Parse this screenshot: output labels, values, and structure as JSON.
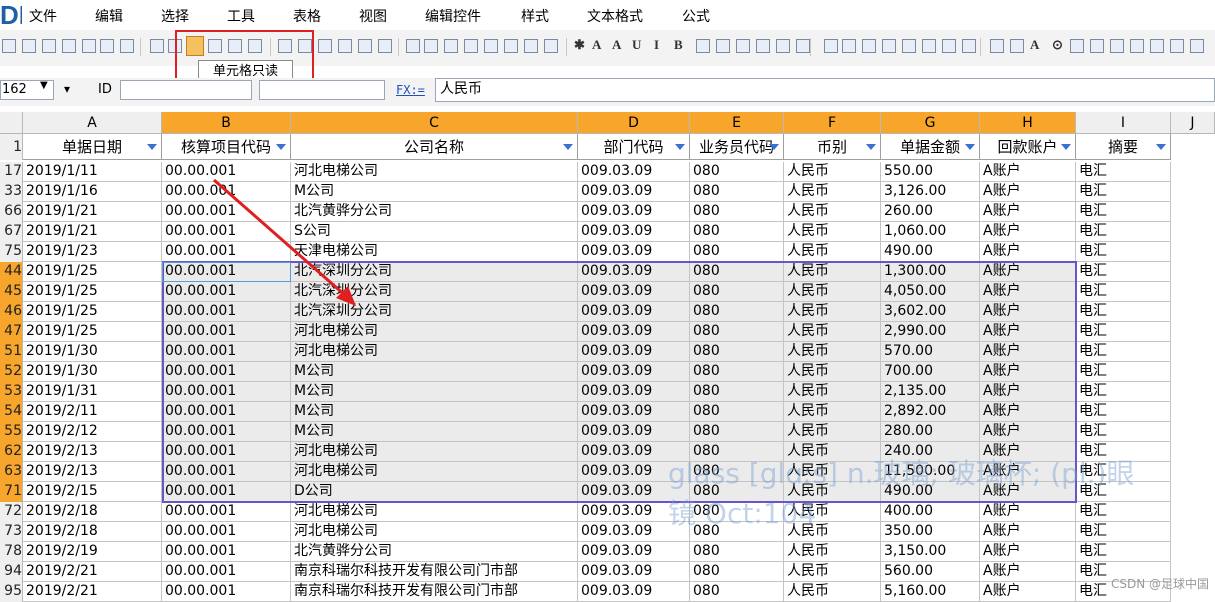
{
  "app": {
    "logo": "DE"
  },
  "menu": {
    "items": [
      "文件",
      "编辑",
      "选择",
      "工具",
      "表格",
      "视图",
      "编辑控件",
      "样式",
      "文本格式",
      "公式"
    ]
  },
  "toolbar": {
    "tooltip": "单元格只读"
  },
  "formula_bar": {
    "name_box": "162",
    "id_label": "ID",
    "id_value": "",
    "id_value2": "",
    "fx_label": "FX:=",
    "formula": "人民币"
  },
  "columns": [
    "A",
    "B",
    "C",
    "D",
    "E",
    "F",
    "G",
    "H",
    "I",
    "J"
  ],
  "header_row_label": "1",
  "headers": [
    "单据日期",
    "核算项目代码",
    "公司名称",
    "部门代码",
    "业务员代码",
    "币别",
    "单据金额",
    "回款账户",
    "摘要"
  ],
  "rows": [
    {
      "n": "17",
      "d": [
        "2019/1/11",
        "00.00.001",
        "河北电梯公司",
        "009.03.09",
        "080",
        "人民币",
        "550.00",
        "A账户",
        "电汇"
      ]
    },
    {
      "n": "33",
      "d": [
        "2019/1/16",
        "00.00.001",
        "M公司",
        "009.03.09",
        "080",
        "人民币",
        "3,126.00",
        "A账户",
        "电汇"
      ]
    },
    {
      "n": "66",
      "d": [
        "2019/1/21",
        "00.00.001",
        "北汽黄骅分公司",
        "009.03.09",
        "080",
        "人民币",
        "260.00",
        "A账户",
        "电汇"
      ]
    },
    {
      "n": "67",
      "d": [
        "2019/1/21",
        "00.00.001",
        "S公司",
        "009.03.09",
        "080",
        "人民币",
        "1,060.00",
        "A账户",
        "电汇"
      ]
    },
    {
      "n": "75",
      "d": [
        "2019/1/23",
        "00.00.001",
        "天津电梯公司",
        "009.03.09",
        "080",
        "人民币",
        "490.00",
        "A账户",
        "电汇"
      ]
    },
    {
      "n": "44",
      "d": [
        "2019/1/25",
        "00.00.001",
        "北汽深圳分公司",
        "009.03.09",
        "080",
        "人民币",
        "1,300.00",
        "A账户",
        "电汇"
      ]
    },
    {
      "n": "45",
      "d": [
        "2019/1/25",
        "00.00.001",
        "北汽深圳分公司",
        "009.03.09",
        "080",
        "人民币",
        "4,050.00",
        "A账户",
        "电汇"
      ]
    },
    {
      "n": "46",
      "d": [
        "2019/1/25",
        "00.00.001",
        "北汽深圳分公司",
        "009.03.09",
        "080",
        "人民币",
        "3,602.00",
        "A账户",
        "电汇"
      ]
    },
    {
      "n": "47",
      "d": [
        "2019/1/25",
        "00.00.001",
        "河北电梯公司",
        "009.03.09",
        "080",
        "人民币",
        "2,990.00",
        "A账户",
        "电汇"
      ]
    },
    {
      "n": "51",
      "d": [
        "2019/1/30",
        "00.00.001",
        "河北电梯公司",
        "009.03.09",
        "080",
        "人民币",
        "570.00",
        "A账户",
        "电汇"
      ]
    },
    {
      "n": "52",
      "d": [
        "2019/1/30",
        "00.00.001",
        "M公司",
        "009.03.09",
        "080",
        "人民币",
        "700.00",
        "A账户",
        "电汇"
      ]
    },
    {
      "n": "53",
      "d": [
        "2019/1/31",
        "00.00.001",
        "M公司",
        "009.03.09",
        "080",
        "人民币",
        "2,135.00",
        "A账户",
        "电汇"
      ]
    },
    {
      "n": "54",
      "d": [
        "2019/2/11",
        "00.00.001",
        "M公司",
        "009.03.09",
        "080",
        "人民币",
        "2,892.00",
        "A账户",
        "电汇"
      ]
    },
    {
      "n": "55",
      "d": [
        "2019/2/12",
        "00.00.001",
        "M公司",
        "009.03.09",
        "080",
        "人民币",
        "280.00",
        "A账户",
        "电汇"
      ]
    },
    {
      "n": "62",
      "d": [
        "2019/2/13",
        "00.00.001",
        "河北电梯公司",
        "009.03.09",
        "080",
        "人民币",
        "240.00",
        "A账户",
        "电汇"
      ]
    },
    {
      "n": "63",
      "d": [
        "2019/2/13",
        "00.00.001",
        "河北电梯公司",
        "009.03.09",
        "080",
        "人民币",
        "11,500.00",
        "A账户",
        "电汇"
      ]
    },
    {
      "n": "71",
      "d": [
        "2019/2/15",
        "00.00.001",
        "D公司",
        "009.03.09",
        "080",
        "人民币",
        "490.00",
        "A账户",
        "电汇"
      ]
    },
    {
      "n": "72",
      "d": [
        "2019/2/18",
        "00.00.001",
        "河北电梯公司",
        "009.03.09",
        "080",
        "人民币",
        "400.00",
        "A账户",
        "电汇"
      ]
    },
    {
      "n": "73",
      "d": [
        "2019/2/18",
        "00.00.001",
        "河北电梯公司",
        "009.03.09",
        "080",
        "人民币",
        "350.00",
        "A账户",
        "电汇"
      ]
    },
    {
      "n": "78",
      "d": [
        "2019/2/19",
        "00.00.001",
        "北汽黄骅分公司",
        "009.03.09",
        "080",
        "人民币",
        "3,150.00",
        "A账户",
        "电汇"
      ]
    },
    {
      "n": "94",
      "d": [
        "2019/2/21",
        "00.00.001",
        "南京科瑞尔科技开发有限公司门市部",
        "009.03.09",
        "080",
        "人民币",
        "560.00",
        "A账户",
        "电汇"
      ]
    },
    {
      "n": "95",
      "d": [
        "2019/2/21",
        "00.00.001",
        "南京科瑞尔科技开发有限公司门市部",
        "009.03.09",
        "080",
        "人民币",
        "5,160.00",
        "A账户",
        "电汇"
      ]
    }
  ],
  "selected_rows": [
    "44",
    "45",
    "46",
    "47",
    "51",
    "52",
    "53",
    "54",
    "55",
    "62",
    "63",
    "71"
  ],
  "colors": {
    "selection_header": "#f7a52b",
    "selection_border": "#6a55c8",
    "selection_fill": "#ebebeb",
    "annotation": "#e02020"
  },
  "watermark": {
    "line1": "glass [glɑːs] n.玻璃; 玻璃杯; (pl.)眼",
    "line2": "镜 Oct:104"
  },
  "credit": "CSDN @足球中国"
}
